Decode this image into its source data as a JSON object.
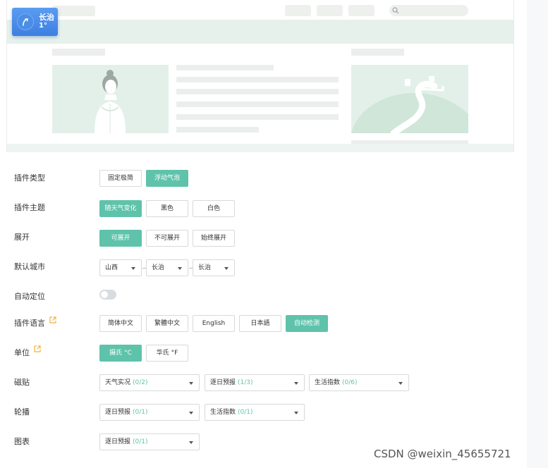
{
  "widget": {
    "city": "长治",
    "temperature": "1°"
  },
  "preview_search": {
    "icon": "search-icon"
  },
  "form": {
    "type": {
      "label": "插件类型",
      "options": [
        "固定极简",
        "浮动气泡"
      ],
      "active": "浮动气泡"
    },
    "theme": {
      "label": "插件主题",
      "options": [
        "随天气变化",
        "黑色",
        "白色"
      ],
      "active": "随天气变化"
    },
    "expand": {
      "label": "展开",
      "options": [
        "可展开",
        "不可展开",
        "始终展开"
      ],
      "active": "可展开"
    },
    "city": {
      "label": "默认城市",
      "province": "山西",
      "city": "长治",
      "district": "长治"
    },
    "autolocate": {
      "label": "自动定位",
      "enabled": false
    },
    "language": {
      "label": "插件语言",
      "options": [
        "简体中文",
        "繁體中文",
        "English",
        "日本語",
        "自动检测"
      ],
      "active": "自动检测"
    },
    "unit": {
      "label": "单位",
      "options": [
        "摄氏 °C",
        "华氏 °F"
      ],
      "active": "摄氏 °C"
    },
    "tiles": {
      "label": "磁贴",
      "selects": [
        {
          "name": "天气实况",
          "count": "(0/2)"
        },
        {
          "name": "逐日预报",
          "count": "(1/3)"
        },
        {
          "name": "生活指数",
          "count": "(0/6)"
        }
      ]
    },
    "carousel": {
      "label": "轮播",
      "selects": [
        {
          "name": "逐日预报",
          "count": "(0/1)"
        },
        {
          "name": "生活指数",
          "count": "(0/1)"
        }
      ]
    },
    "chart": {
      "label": "图表",
      "selects": [
        {
          "name": "逐日预报",
          "count": "(0/1)"
        }
      ]
    }
  },
  "watermark": "CSDN @weixin_45655721",
  "colors": {
    "accent": "#5ec3aa",
    "badge": "#4a8ee6",
    "preview_tint": "#e3f0ea"
  }
}
